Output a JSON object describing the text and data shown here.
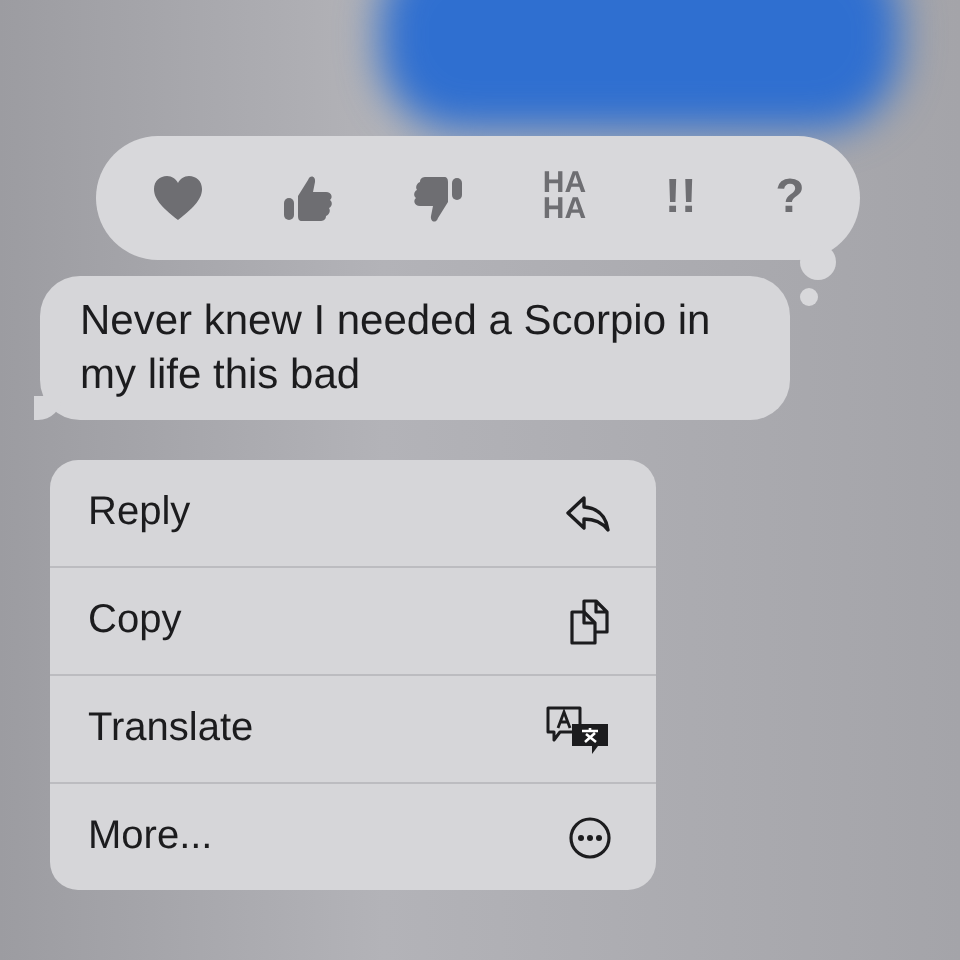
{
  "reactions": [
    {
      "kind": "heart"
    },
    {
      "kind": "thumbs-up"
    },
    {
      "kind": "thumbs-down"
    },
    {
      "kind": "text",
      "lines": [
        "HA",
        "HA"
      ]
    },
    {
      "kind": "text",
      "lines": [
        "!!"
      ]
    },
    {
      "kind": "text",
      "lines": [
        "?"
      ]
    }
  ],
  "message": {
    "text": "Never knew I needed a Scorpio in my life this bad"
  },
  "menu": [
    {
      "label": "Reply",
      "kind": "reply"
    },
    {
      "label": "Copy",
      "kind": "copy"
    },
    {
      "label": "Translate",
      "kind": "translate"
    },
    {
      "label": "More...",
      "kind": "more"
    }
  ]
}
